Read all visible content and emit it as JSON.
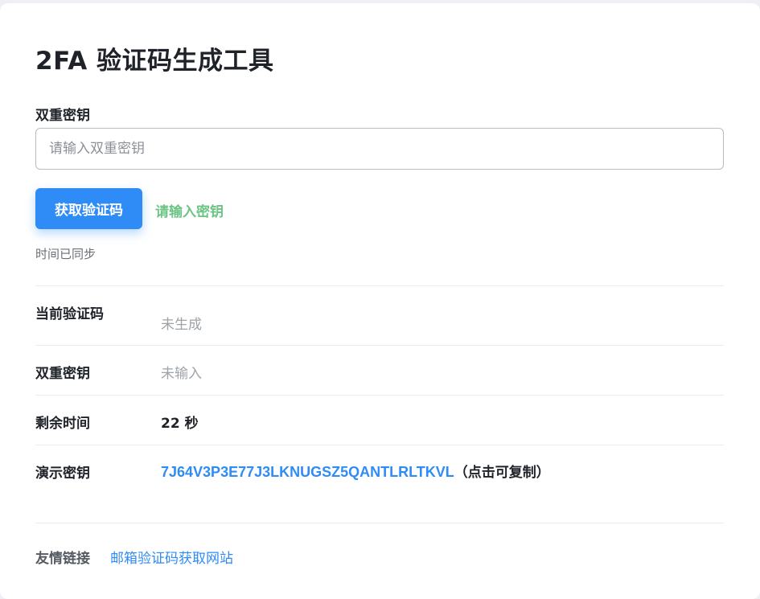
{
  "page": {
    "title": "2FA 验证码生成工具"
  },
  "secret_field": {
    "label": "双重密钥",
    "placeholder": "请输入双重密钥",
    "value": ""
  },
  "actions": {
    "get_code_label": "获取验证码",
    "hint": "请输入密钥"
  },
  "sync_status": "时间已同步",
  "info_rows": {
    "current_code": {
      "label": "当前验证码",
      "value": "未生成"
    },
    "secret": {
      "label": "双重密钥",
      "value": "未输入"
    },
    "remaining": {
      "label": "剩余时间",
      "value": "22 秒"
    },
    "demo": {
      "label": "演示密钥",
      "key": "7J64V3P3E77J3LKNUGSZ5QANTLRLTKVL",
      "note": "（点击可复制）"
    }
  },
  "footer": {
    "label": "友情链接",
    "link_text": "邮箱验证码获取网站"
  },
  "colors": {
    "accent": "#2f8bf5",
    "hint_green": "#6cc585",
    "muted": "#9ea3aa"
  }
}
